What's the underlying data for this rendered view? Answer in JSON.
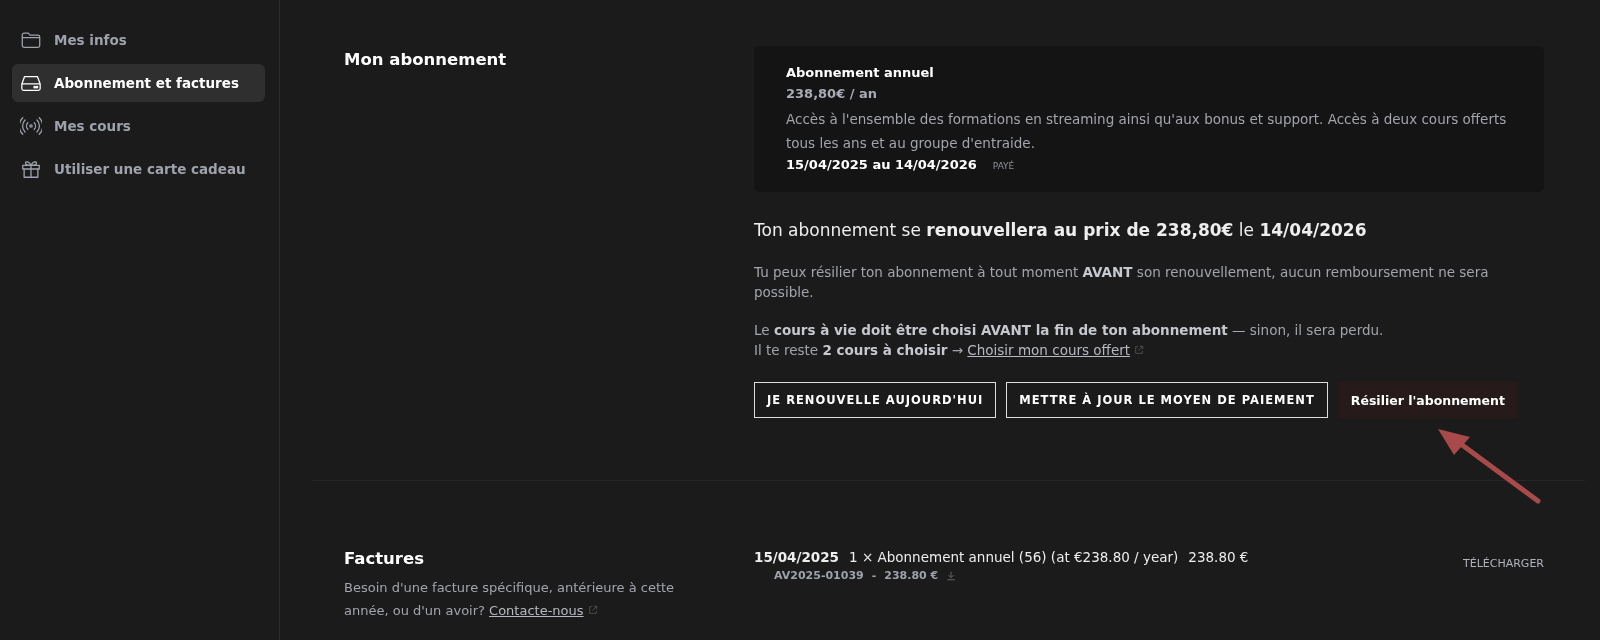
{
  "sidebar": {
    "items": [
      {
        "label": "Mes infos",
        "kind": "folder",
        "selected": false
      },
      {
        "label": "Abonnement et factures",
        "kind": "drive",
        "selected": true
      },
      {
        "label": "Mes cours",
        "kind": "broadcast",
        "selected": false
      },
      {
        "label": "Utiliser une carte cadeau",
        "kind": "gift",
        "selected": false
      }
    ]
  },
  "subscription": {
    "heading": "Mon abonnement",
    "card": {
      "title": "Abonnement annuel",
      "price": "238,80€ / an",
      "description": "Accès à l'ensemble des formations en streaming ainsi qu'aux bonus et support. Accès à deux cours offerts tous les ans et au groupe d'entraide.",
      "period": "15/04/2025 au 14/04/2026",
      "status": "PAYÉ"
    },
    "renewal": "Ton abonnement se **renouvellera au prix de 238,80€** le **14/04/2026**",
    "notice": "Tu peux résilier ton abonnement à tout moment **AVANT** son renouvellement, aucun remboursement ne sera possible.",
    "lifetime": "Le **cours à vie doit être choisi AVANT la fin de ton abonnement** — sinon, il sera perdu.",
    "remaining": "Il te reste **2 cours à choisir** →",
    "remaining_link": "Choisir mon cours offert",
    "buttons": [
      {
        "label": "JE RENOUVELLE AUJOURD'HUI",
        "kind": "outline"
      },
      {
        "label": "METTRE À JOUR LE MOYEN DE PAIEMENT",
        "kind": "outline"
      },
      {
        "label": "Résilier l'abonnement",
        "kind": "danger"
      }
    ]
  },
  "invoices": {
    "heading": "Factures",
    "help": "Besoin d'une facture spécifique, antérieure à cette année, ou d'un avoir?",
    "help_link": "Contacte-nous",
    "rows": [
      {
        "date": "15/04/2025",
        "line": "1 × Abonnement annuel (56) (at €238.80 / year)",
        "amount": "238.80 €",
        "number": "AV2025-01039",
        "separator": "-",
        "total": "238.80 €",
        "action": "TÉLÉCHARGER"
      }
    ]
  }
}
